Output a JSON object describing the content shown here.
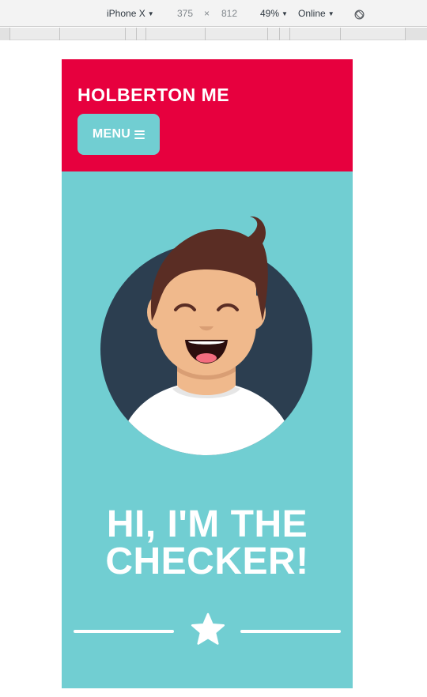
{
  "devtools": {
    "device": "iPhone X",
    "width": "375",
    "times": "×",
    "height": "812",
    "zoom": "49%",
    "network": "Online",
    "rotate_icon": "rotate-icon"
  },
  "site": {
    "brand": "HOLBERTON ME",
    "menu_label": "MENU",
    "menu_icon": "hamburger-icon",
    "headline_line1": "HI, I'M THE",
    "headline_line2": "CHECKER!",
    "divider_icon": "star-icon",
    "colors": {
      "header_bg": "#e7003e",
      "page_bg": "#71ced2",
      "avatar_circle": "#2c3e50",
      "text": "#ffffff"
    }
  }
}
